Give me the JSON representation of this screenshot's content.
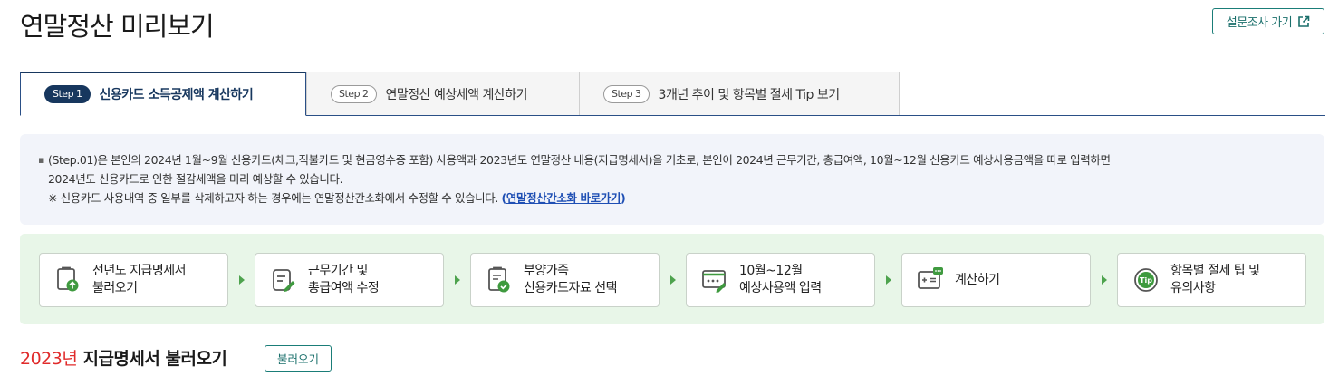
{
  "header": {
    "title": "연말정산 미리보기",
    "survey_button": "설문조사 가기",
    "survey_icon": "external-link-icon"
  },
  "tabs": [
    {
      "step": "Step 1",
      "label": "신용카드 소득공제액 계산하기",
      "active": true
    },
    {
      "step": "Step 2",
      "label": "연말정산 예상세액 계산하기",
      "active": false
    },
    {
      "step": "Step 3",
      "label": "3개년 추이 및 항목별 절세 Tip 보기",
      "active": false
    }
  ],
  "info": {
    "line1": "(Step.01)은 본인의 2024년 1월~9월 신용카드(체크,직불카드 및 현금영수증 포함) 사용액과 2023년도 연말정산 내용(지급명세서)을 기초로, 본인이 2024년 근무기간, 총급여액, 10월~12월 신용카드 예상사용금액을 따로 입력하면",
    "line2": "2024년도 신용카드로 인한 절감세액을 미리 예상할 수 있습니다.",
    "note": "※ 신용카드 사용내역 중 일부를 삭제하고자 하는 경우에는 연말정산간소화에서 수정할 수 있습니다.",
    "paren_open": "(",
    "link": "연말정산간소화 바로가기",
    "paren_close": ")"
  },
  "process": [
    {
      "label": "전년도 지급명세서\n불러오기",
      "icon": "document-upload-icon"
    },
    {
      "label": "근무기간 및\n총급여액 수정",
      "icon": "document-edit-icon"
    },
    {
      "label": "부양가족\n신용카드자료 선택",
      "icon": "document-check-icon"
    },
    {
      "label": "10월~12월\n예상사용액 입력",
      "icon": "input-screen-icon"
    },
    {
      "label": "계산하기",
      "icon": "calculator-icon"
    },
    {
      "label": "항목별 절세 팁 및\n유의사항",
      "icon": "tip-badge-icon"
    }
  ],
  "section": {
    "year": "2023년",
    "title": "지급명세서 불러오기",
    "load_button": "불러오기"
  },
  "colors": {
    "accent_navy": "#17375e",
    "accent_teal": "#1a7d78",
    "process_bg": "#e8f6e8",
    "info_bg": "#f2f4fa",
    "highlight_red": "#e02b2b",
    "icon_green": "#3f9a3f"
  }
}
